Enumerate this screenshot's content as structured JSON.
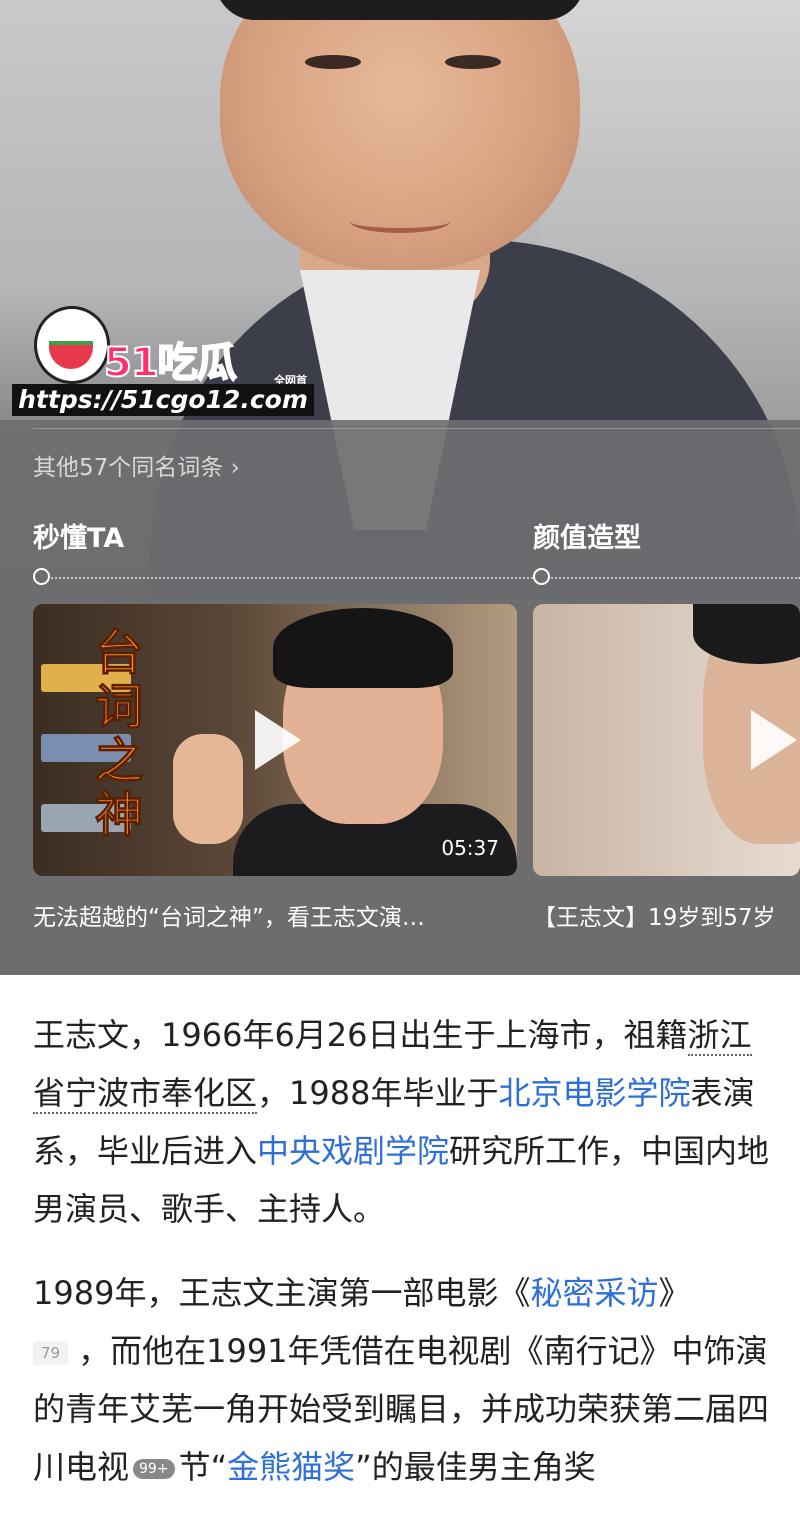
{
  "watermark": {
    "brand": "51吃瓜",
    "tag": "全网首发",
    "url": "https://51cgo12.com"
  },
  "hero": {
    "other_entries": "其他57个同名词条 ›",
    "sections": [
      "秒懂TA",
      "颜值造型"
    ]
  },
  "videos": [
    {
      "poster_title": "台词之神",
      "duration": "05:37",
      "caption": "无法超越的“台词之神”，看王志文演…"
    },
    {
      "caption": "【王志文】19岁到57岁"
    }
  ],
  "article": {
    "p1": {
      "t1": "王志文，1966年6月26日出生于上海市，祖籍",
      "link1": "浙江省宁波市奉化区",
      "t2": "，1988年毕业于",
      "link2": "北京电影学院",
      "t3": "表演系，毕业后进入",
      "link3": "中央戏剧学院",
      "t4": "研究所工作，中国内地男演员、歌手、主持人。"
    },
    "p2": {
      "t1": "1989年，王志文主演第一部电影《",
      "link1": "秘密采访",
      "t2": "》",
      "ref": "79",
      "t3": "，而他在1991年凭借在电视剧《南行记》中饰演的青年艾芜一角开始受到瞩目，并成功荣获第二届四川电视",
      "badge": "99+",
      "t4": "节“",
      "link2": "金熊猫奖",
      "t5": "”的最佳男主角奖"
    }
  }
}
